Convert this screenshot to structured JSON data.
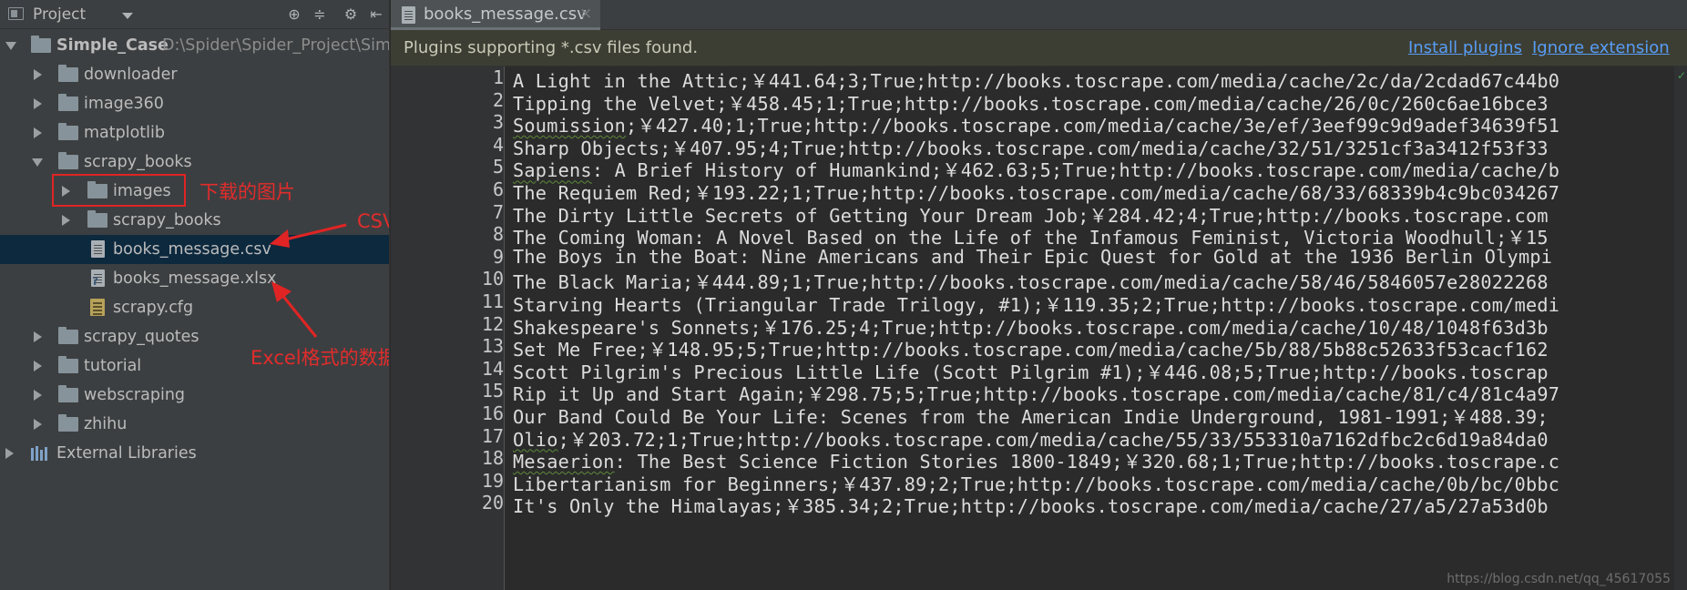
{
  "project_panel": {
    "title": "Project",
    "tree": [
      {
        "label": "Simple_Case",
        "path": "D:\\Spider\\Spider_Project\\Sim",
        "type": "root"
      },
      {
        "label": "downloader",
        "type": "folder"
      },
      {
        "label": "image360",
        "type": "folder"
      },
      {
        "label": "matplotlib",
        "type": "folder"
      },
      {
        "label": "scrapy_books",
        "type": "folder"
      },
      {
        "label": "images",
        "type": "folder"
      },
      {
        "label": "scrapy_books",
        "type": "folder"
      },
      {
        "label": "books_message.csv",
        "type": "file"
      },
      {
        "label": "books_message.xlsx",
        "type": "file"
      },
      {
        "label": "scrapy.cfg",
        "type": "file"
      },
      {
        "label": "scrapy_quotes",
        "type": "folder"
      },
      {
        "label": "tutorial",
        "type": "folder"
      },
      {
        "label": "webscraping",
        "type": "folder"
      },
      {
        "label": "zhihu",
        "type": "folder"
      },
      {
        "label": "External Libraries",
        "type": "library"
      }
    ]
  },
  "annotations": {
    "images_note": "下载的图片",
    "csv_note": "CSV格式的数据",
    "excel_note": "Excel格式的数据"
  },
  "editor": {
    "tab_label": "books_message.csv",
    "notice": {
      "text": "Plugins supporting *.csv files found.",
      "install_link": "Install plugins",
      "ignore_link": "Ignore extension"
    },
    "line_numbers": [
      "1",
      "2",
      "3",
      "4",
      "5",
      "6",
      "7",
      "8",
      "9",
      "10",
      "11",
      "12",
      "13",
      "14",
      "15",
      "16",
      "17",
      "18",
      "19",
      "20"
    ],
    "lines": [
      {
        "head": "",
        "rest": "A Light in the Attic;￥441.64;3;True;http://books.toscrape.com/media/cache/2c/da/2cdad67c44b0"
      },
      {
        "head": "",
        "rest": "Tipping the Velvet;￥458.45;1;True;http://books.toscrape.com/media/cache/26/0c/260c6ae16bce3"
      },
      {
        "head": "Soumission",
        "rest": ";￥427.40;1;True;http://books.toscrape.com/media/cache/3e/ef/3eef99c9d9adef34639f51"
      },
      {
        "head": "",
        "rest": "Sharp Objects;￥407.95;4;True;http://books.toscrape.com/media/cache/32/51/3251cf3a3412f53f33"
      },
      {
        "head": "Sapiens",
        "rest": ": A Brief History of Humankind;￥462.63;5;True;http://books.toscrape.com/media/cache/b"
      },
      {
        "head": "",
        "rest": "The Requiem Red;￥193.22;1;True;http://books.toscrape.com/media/cache/68/33/68339b4c9bc034267"
      },
      {
        "head": "",
        "rest": "The Dirty Little Secrets of Getting Your Dream Job;￥284.42;4;True;http://books.toscrape.com"
      },
      {
        "head": "",
        "rest": "The Coming Woman: A Novel Based on the Life of the Infamous Feminist, Victoria Woodhull;￥15"
      },
      {
        "head": "",
        "rest": "The Boys in the Boat: Nine Americans and Their Epic Quest for Gold at the 1936 Berlin Olympi"
      },
      {
        "head": "",
        "rest": "The Black Maria;￥444.89;1;True;http://books.toscrape.com/media/cache/58/46/5846057e28022268"
      },
      {
        "head": "",
        "rest": "Starving Hearts (Triangular Trade Trilogy, #1);￥119.35;2;True;http://books.toscrape.com/medi"
      },
      {
        "head": "",
        "rest": "Shakespeare's Sonnets;￥176.25;4;True;http://books.toscrape.com/media/cache/10/48/1048f63d3b"
      },
      {
        "head": "",
        "rest": "Set Me Free;￥148.95;5;True;http://books.toscrape.com/media/cache/5b/88/5b88c52633f53cacf162"
      },
      {
        "head": "",
        "rest": "Scott Pilgrim's Precious Little Life (Scott Pilgrim #1);￥446.08;5;True;http://books.toscrap"
      },
      {
        "head": "",
        "rest": "Rip it Up and Start Again;￥298.75;5;True;http://books.toscrape.com/media/cache/81/c4/81c4a97"
      },
      {
        "head": "",
        "rest": "Our Band Could Be Your Life: Scenes from the American Indie Underground, 1981-1991;￥488.39;"
      },
      {
        "head": "Olio",
        "rest": ";￥203.72;1;True;http://books.toscrape.com/media/cache/55/33/553310a7162dfbc2c6d19a84da0"
      },
      {
        "head": "Mesaerion",
        "rest": ": The Best Science Fiction Stories 1800-1849;￥320.68;1;True;http://books.toscrape.c"
      },
      {
        "head": "",
        "rest": "Libertarianism for Beginners;￥437.89;2;True;http://books.toscrape.com/media/cache/0b/bc/0bbc"
      },
      {
        "head": "",
        "rest": "It's Only the Himalayas;￥385.34;2;True;http://books.toscrape.com/media/cache/27/a5/27a53d0b"
      }
    ],
    "watermark": "https://blog.csdn.net/qq_45617055"
  },
  "colors": {
    "panel_bg": "#3c3f41",
    "editor_bg": "#2b2b2b",
    "selection": "#0d293e",
    "annotation_red": "#e02424",
    "link_blue": "#589df6"
  }
}
